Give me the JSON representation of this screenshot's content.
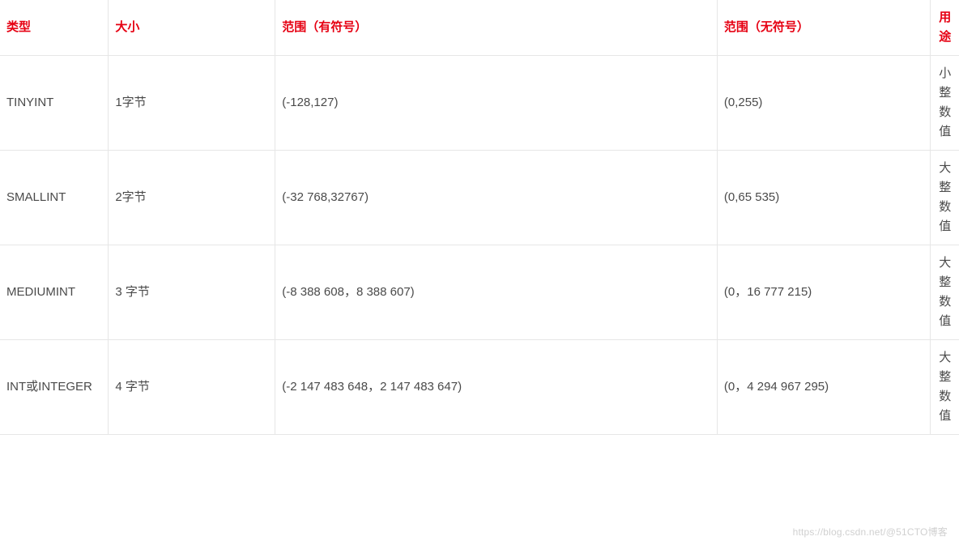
{
  "table": {
    "headers": {
      "type": "类型",
      "size": "大小",
      "signed": "范围（有符号）",
      "unsigned": "范围（无符号）",
      "usage": "用途"
    },
    "rows": [
      {
        "type": "TINYINT",
        "size": "1字节",
        "signed": " (-128,127)",
        "unsigned": " (0,255)",
        "usage": "小整数值"
      },
      {
        "type": "SMALLINT",
        "size": "2字节",
        "signed": " (-32 768,32767)",
        "unsigned": " (0,65 535)",
        "usage": "大整数值"
      },
      {
        "type": "MEDIUMINT",
        "size": "3 字节",
        "signed": "(-8 388 608，8 388 607)",
        "unsigned": "(0，16 777 215)",
        "usage": "大整数值"
      },
      {
        "type": "INT或INTEGER",
        "size": "4 字节",
        "signed": "(-2 147 483 648，2 147 483 647)",
        "unsigned": "(0，4 294 967 295)",
        "usage": "大整数值"
      }
    ]
  },
  "watermark": "https://blog.csdn.net/@51CTO博客"
}
